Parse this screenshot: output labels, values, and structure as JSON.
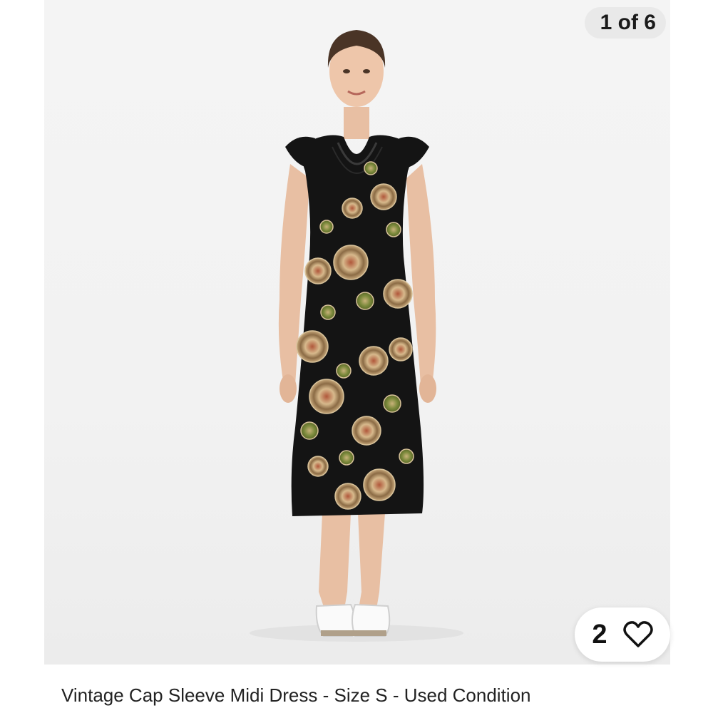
{
  "gallery": {
    "counter": "1 of 6",
    "likes": "2",
    "icons": {
      "like": "heart-outline-icon"
    }
  },
  "listing": {
    "title": "Vintage Cap Sleeve Midi Dress - Size S - Used Condition"
  },
  "colors": {
    "background": "#ffffff",
    "photo_backdrop": "#f2f2f2",
    "dress": "#141414",
    "print_green": "#7c8a3c",
    "print_tan": "#c8a87a"
  }
}
